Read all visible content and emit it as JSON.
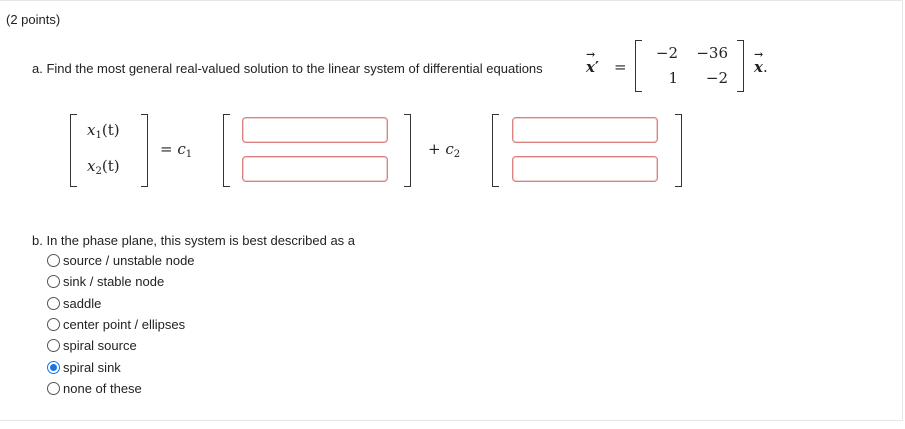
{
  "points_label": "(2 points)",
  "part_a": {
    "prompt": "a. Find the most general real-valued solution to the linear system of differential equations",
    "lhs": "x",
    "prime": "′",
    "equals": "=",
    "matrix": [
      [
        "−2",
        "−36"
      ],
      [
        "1",
        "−2"
      ]
    ],
    "rhs_vec": "x",
    "period": ".",
    "row1_label": "x",
    "row1_sub": "1",
    "row1_arg": "(t)",
    "row2_label": "x",
    "row2_sub": "2",
    "row2_arg": "(t)",
    "eq_c1": "= c",
    "c1_sub": "1",
    "plus_c2": "+ c",
    "c2_sub": "2",
    "answers": [
      "",
      "",
      "",
      ""
    ]
  },
  "part_b": {
    "prompt": "b. In the phase plane, this system is best described as a",
    "options": [
      {
        "label": "source / unstable node",
        "selected": false
      },
      {
        "label": "sink / stable node",
        "selected": false
      },
      {
        "label": "saddle",
        "selected": false
      },
      {
        "label": "center point / ellipses",
        "selected": false
      },
      {
        "label": "spiral source",
        "selected": false
      },
      {
        "label": "spiral sink",
        "selected": true
      },
      {
        "label": "none of these",
        "selected": false
      }
    ]
  },
  "colors": {
    "accent": "#1a73e8",
    "input_border": "#d98080"
  }
}
